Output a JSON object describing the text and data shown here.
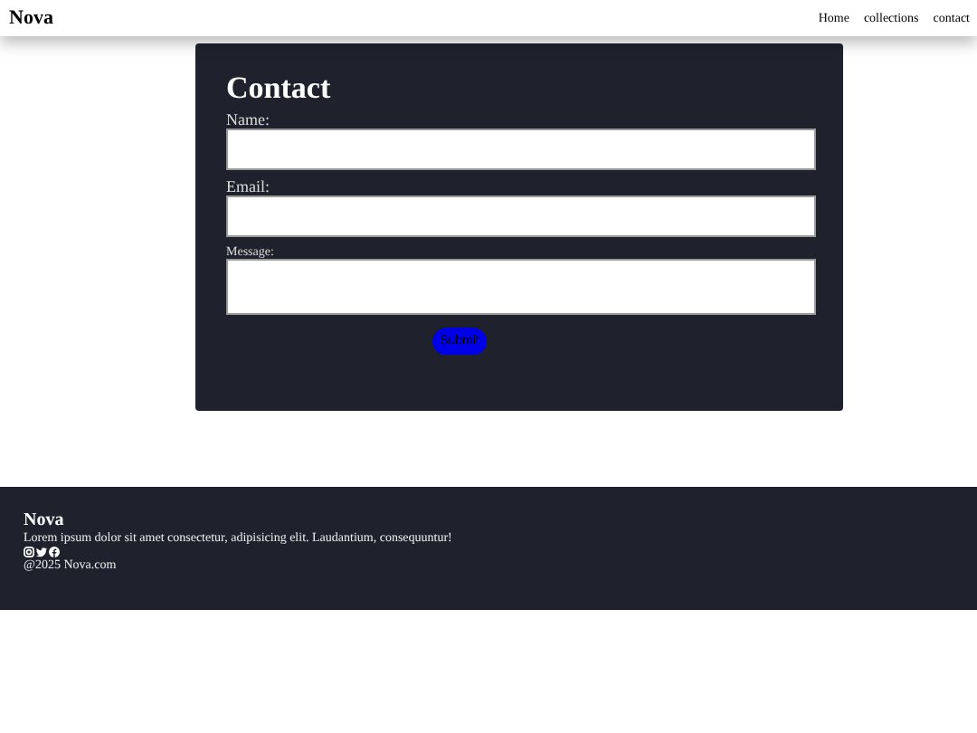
{
  "navbar": {
    "brand": "Nova",
    "links": [
      {
        "label": "Home"
      },
      {
        "label": "collections"
      },
      {
        "label": "contact"
      }
    ]
  },
  "contact_form": {
    "title": "Contact",
    "fields": [
      {
        "label": "Name:",
        "kind": "input",
        "small": false
      },
      {
        "label": "Email:",
        "kind": "input",
        "small": false
      },
      {
        "label": "Message:",
        "kind": "textarea",
        "small": true
      }
    ],
    "submit": "Submit"
  },
  "footer": {
    "brand": "Nova",
    "description": "Lorem ipsum dolor sit amet consectetur, adipisicing elit. Laudantium, consequuntur!",
    "social": [
      {
        "kind": "instagram"
      },
      {
        "kind": "twitter"
      },
      {
        "kind": "facebook"
      }
    ],
    "copyright": "@2025 Nova.com"
  }
}
